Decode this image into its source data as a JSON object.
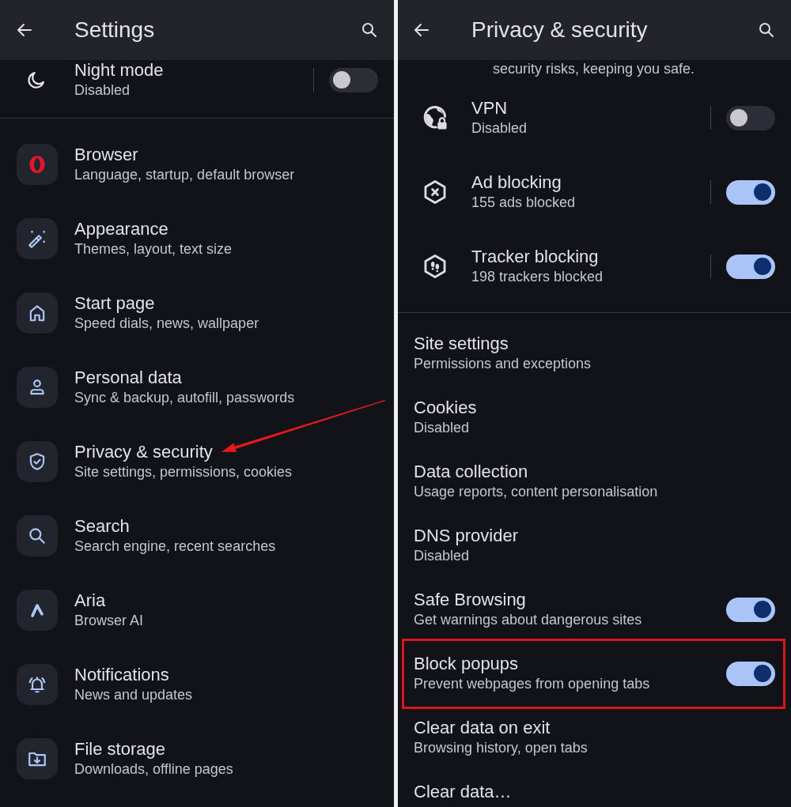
{
  "settings_screen": {
    "title": "Settings",
    "night_mode": {
      "title": "Night mode",
      "subtitle": "Disabled",
      "on": false
    },
    "items": [
      {
        "title": "Browser",
        "subtitle": "Language, startup, default browser",
        "arrow": false
      },
      {
        "title": "Appearance",
        "subtitle": "Themes, layout, text size",
        "arrow": false
      },
      {
        "title": "Start page",
        "subtitle": "Speed dials, news, wallpaper",
        "arrow": false
      },
      {
        "title": "Personal data",
        "subtitle": "Sync & backup, autofill, passwords",
        "arrow": false
      },
      {
        "title": "Privacy & security",
        "subtitle": "Site settings, permissions, cookies",
        "arrow": true
      },
      {
        "title": "Search",
        "subtitle": "Search engine, recent searches",
        "arrow": false
      },
      {
        "title": "Aria",
        "subtitle": "Browser AI",
        "arrow": false
      },
      {
        "title": "Notifications",
        "subtitle": "News and updates",
        "arrow": false
      },
      {
        "title": "File storage",
        "subtitle": "Downloads, offline pages",
        "arrow": false
      }
    ]
  },
  "privacy_screen": {
    "title": "Privacy & security",
    "intro_fragment": "security risks, keeping you safe.",
    "protection_items": [
      {
        "title": "VPN",
        "subtitle": "Disabled",
        "on": false
      },
      {
        "title": "Ad blocking",
        "subtitle": "155 ads blocked",
        "on": true
      },
      {
        "title": "Tracker blocking",
        "subtitle": "198 trackers blocked",
        "on": true
      }
    ],
    "items": [
      {
        "kind": "link",
        "title": "Site settings",
        "subtitle": "Permissions and exceptions",
        "highlighted": false
      },
      {
        "kind": "link",
        "title": "Cookies",
        "subtitle": "Disabled",
        "highlighted": false
      },
      {
        "kind": "link",
        "title": "Data collection",
        "subtitle": "Usage reports, content personalisation",
        "highlighted": false
      },
      {
        "kind": "link",
        "title": "DNS provider",
        "subtitle": "Disabled",
        "highlighted": false
      },
      {
        "kind": "switch",
        "title": "Safe Browsing",
        "subtitle": "Get warnings about dangerous sites",
        "on": true,
        "highlighted": false
      },
      {
        "kind": "switch",
        "title": "Block popups",
        "subtitle": "Prevent webpages from opening tabs",
        "on": true,
        "highlighted": true
      },
      {
        "kind": "link",
        "title": "Clear data on exit",
        "subtitle": "Browsing history, open tabs",
        "highlighted": false
      },
      {
        "kind": "link",
        "title": "Clear data…",
        "highlighted": false
      }
    ]
  }
}
